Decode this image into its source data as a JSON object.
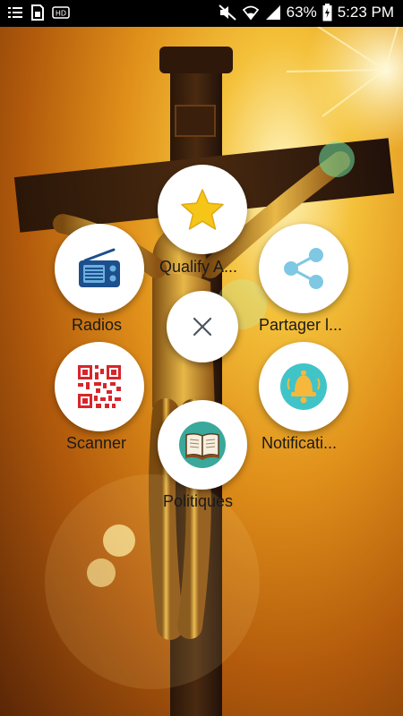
{
  "status_bar": {
    "battery_percent": "63%",
    "time": "5:23 PM",
    "icons": [
      "list-icon",
      "sim-icon",
      "hd-icon",
      "mute-icon",
      "wifi-icon",
      "signal-icon",
      "battery-charging-icon"
    ]
  },
  "menu": {
    "items": [
      {
        "id": "qualify",
        "label": "Qualify A...",
        "icon": "star-icon"
      },
      {
        "id": "radios",
        "label": "Radios",
        "icon": "radio-icon"
      },
      {
        "id": "share",
        "label": "Partager l...",
        "icon": "share-icon"
      },
      {
        "id": "scanner",
        "label": "Scanner",
        "icon": "qr-code-icon"
      },
      {
        "id": "notifications",
        "label": "Notificati...",
        "icon": "bell-icon"
      },
      {
        "id": "politiques",
        "label": "Politiques",
        "icon": "book-icon"
      }
    ],
    "close_icon": "close-icon"
  },
  "colors": {
    "star": "#f5c518",
    "radio": "#1d4f8c",
    "share": "#7ec8e3",
    "bell_bg": "#40c4c8",
    "bell": "#f5b83d",
    "book_bg": "#3aa89a",
    "qr": "#d7262b"
  }
}
